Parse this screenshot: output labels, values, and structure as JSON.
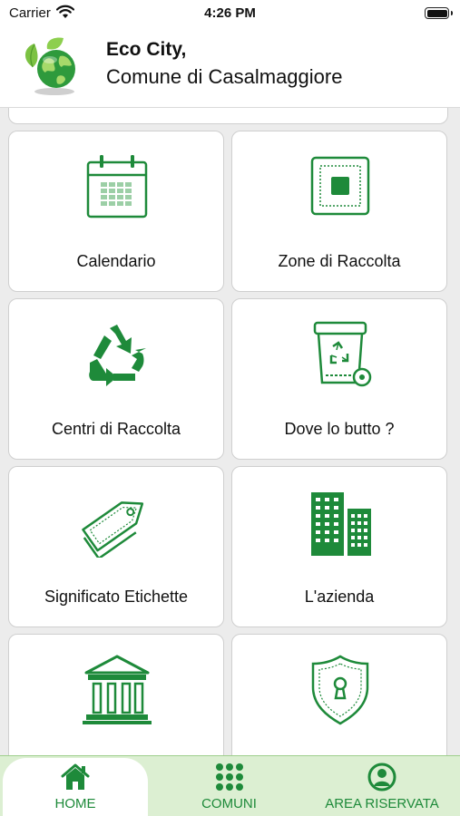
{
  "status_bar": {
    "carrier": "Carrier",
    "time": "4:26 PM"
  },
  "header": {
    "title": "Eco City,",
    "subtitle": "Comune di Casalmaggiore"
  },
  "tiles": [
    {
      "label": "Calendario",
      "icon": "calendar-icon"
    },
    {
      "label": "Zone di Raccolta",
      "icon": "zone-map-icon"
    },
    {
      "label": "Centri di Raccolta",
      "icon": "recycle-icon"
    },
    {
      "label": "Dove lo butto ?",
      "icon": "recycle-bin-icon"
    },
    {
      "label": "Significato Etichette",
      "icon": "tag-icon"
    },
    {
      "label": "L'azienda",
      "icon": "building-icon"
    },
    {
      "label": "",
      "icon": "institution-icon"
    },
    {
      "label": "",
      "icon": "shield-lock-icon"
    }
  ],
  "tab_bar": {
    "tabs": [
      {
        "label": "HOME",
        "icon": "home-icon",
        "active": true
      },
      {
        "label": "COMUNI",
        "icon": "grid-dots-icon",
        "active": false
      },
      {
        "label": "AREA RISERVATA",
        "icon": "user-circle-icon",
        "active": false
      }
    ]
  },
  "colors": {
    "accent": "#1e8a3a",
    "tab_background": "#dcefd2"
  }
}
